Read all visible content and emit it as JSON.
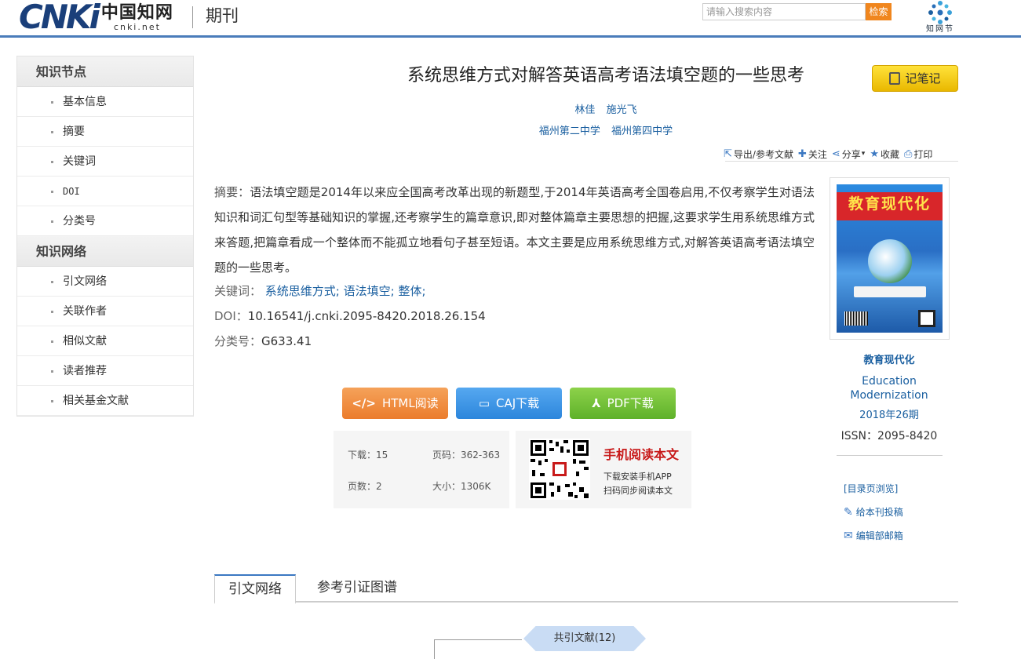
{
  "header": {
    "logo_text": "CNKi",
    "logo_zh": "中国知网",
    "logo_url": "cnki.net",
    "section": "期刊",
    "search_placeholder": "请输入搜索内容",
    "search_button": "检索",
    "zhiwangjie_label": "知网节"
  },
  "sidebar": {
    "groups": [
      {
        "title": "知识节点",
        "items": [
          "基本信息",
          "摘要",
          "关键词",
          "DOI",
          "分类号"
        ]
      },
      {
        "title": "知识网络",
        "items": [
          "引文网络",
          "关联作者",
          "相似文献",
          "读者推荐",
          "相关基金文献"
        ]
      }
    ]
  },
  "article": {
    "title": "系统思维方式对解答英语高考语法填空题的一些思考",
    "note_button": "记笔记",
    "authors": [
      "林佳",
      "施光飞"
    ],
    "orgs": [
      "福州第二中学",
      "福州第四中学"
    ],
    "toolbar": {
      "export": "导出/参考文献",
      "follow": "关注",
      "share": "分享",
      "collect": "收藏",
      "print": "打印"
    },
    "abstract_label": "摘要：",
    "abstract": "语法填空题是2014年以来应全国高考改革出现的新题型,于2014年英语高考全国卷启用,不仅考察学生对语法知识和词汇句型等基础知识的掌握,还考察学生的篇章意识,即对整体篇章主要思想的把握,这要求学生用系统思维方式来答题,把篇章看成一个整体而不能孤立地看句子甚至短语。本文主要是应用系统思维方式,对解答英语高考语法填空题的一些思考。",
    "keywords_label": "关键词：",
    "keywords": [
      "系统思维方式;",
      "语法填空;",
      "整体;"
    ],
    "doi_label": "DOI：",
    "doi": "10.16541/j.cnki.2095-8420.2018.26.154",
    "class_label": "分类号：",
    "class_no": "G633.41"
  },
  "downloads": {
    "html": "HTML阅读",
    "caj": "CAJ下载",
    "pdf": "PDF下载"
  },
  "stats": {
    "downloads_label": "下载：",
    "downloads": "15",
    "pages_label": "页码：",
    "pages": "362-363",
    "page_count_label": "页数：",
    "page_count": "2",
    "size_label": "大小：",
    "size": "1306K"
  },
  "mobile": {
    "title": "手机阅读本文",
    "line1": "下载安装手机APP",
    "line2": "扫码同步阅读本文"
  },
  "journal": {
    "cover_title": "教育现代化",
    "name": "教育现代化",
    "english": "Education Modernization",
    "issue": "2018年26期",
    "issn": "ISSN：2095-8420",
    "toc_link": "[目录页浏览]",
    "submit_link": "给本刊投稿",
    "email_link": "编辑部邮箱"
  },
  "tabs": [
    "引文网络",
    "参考引证图谱"
  ],
  "network": {
    "cocite": "共引文献(12)"
  },
  "colors": {
    "link": "#1a5fa0",
    "header_rule": "#4a7cba",
    "html_btn": "#eb7c2c",
    "caj_btn": "#2c86dc",
    "pdf_btn": "#5eb12a",
    "note_btn": "#f5c800",
    "mobile_title": "#c81a1a"
  }
}
